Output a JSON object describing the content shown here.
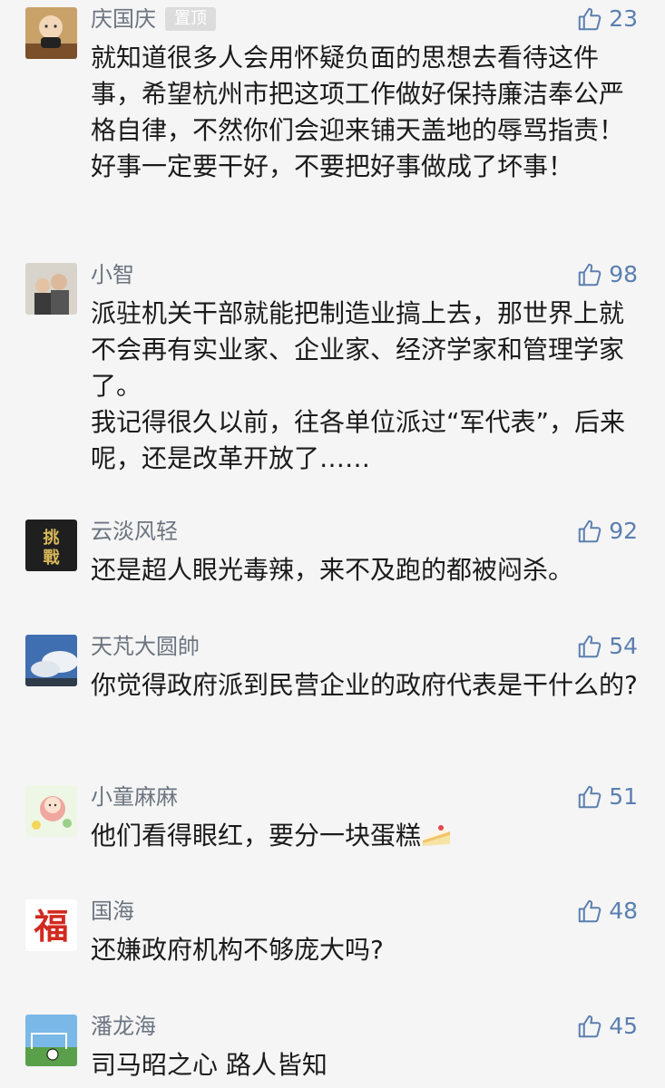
{
  "comments": [
    {
      "user": "庆国庆",
      "pinned_label": "置顶",
      "likes": "23",
      "paragraphs": [
        "就知道很多人会用怀疑负面的思想去看待这件事，希望杭州市把这项工作做好保持廉洁奉公严格自律，不然你们会迎来铺天盖地的辱骂指责！好事一定要干好，不要把好事做成了坏事！"
      ]
    },
    {
      "user": "小智",
      "likes": "98",
      "paragraphs": [
        "派驻机关干部就能把制造业搞上去，那世界上就不会再有实业家、企业家、经济学家和管理学家了。",
        "我记得很久以前，往各单位派过“军代表”，后来呢，还是改革开放了……"
      ]
    },
    {
      "user": "云淡风轻",
      "likes": "92",
      "paragraphs": [
        "还是超人眼光毒辣，来不及跑的都被闷杀。"
      ]
    },
    {
      "user": "天芃大圆帥",
      "likes": "54",
      "paragraphs": [
        "你觉得政府派到民营企业的政府代表是干什么的?"
      ]
    },
    {
      "user": "小童麻麻",
      "likes": "51",
      "paragraphs": [
        "他们看得眼红，要分一块蛋糕"
      ],
      "emoji": "cake-emoji"
    },
    {
      "user": "国海",
      "likes": "48",
      "paragraphs": [
        "还嫌政府机构不够庞大吗?"
      ],
      "avatar_text": "福"
    },
    {
      "user": "潘龙海",
      "likes": "45",
      "paragraphs": [
        "司马昭之心 路人皆知"
      ]
    }
  ],
  "colors": {
    "username": "#6c7480",
    "like": "#5b7fb0",
    "text": "#1b1b1b",
    "background": "#f5f5f5"
  },
  "icons": {
    "like": "thumbs-up-icon"
  }
}
